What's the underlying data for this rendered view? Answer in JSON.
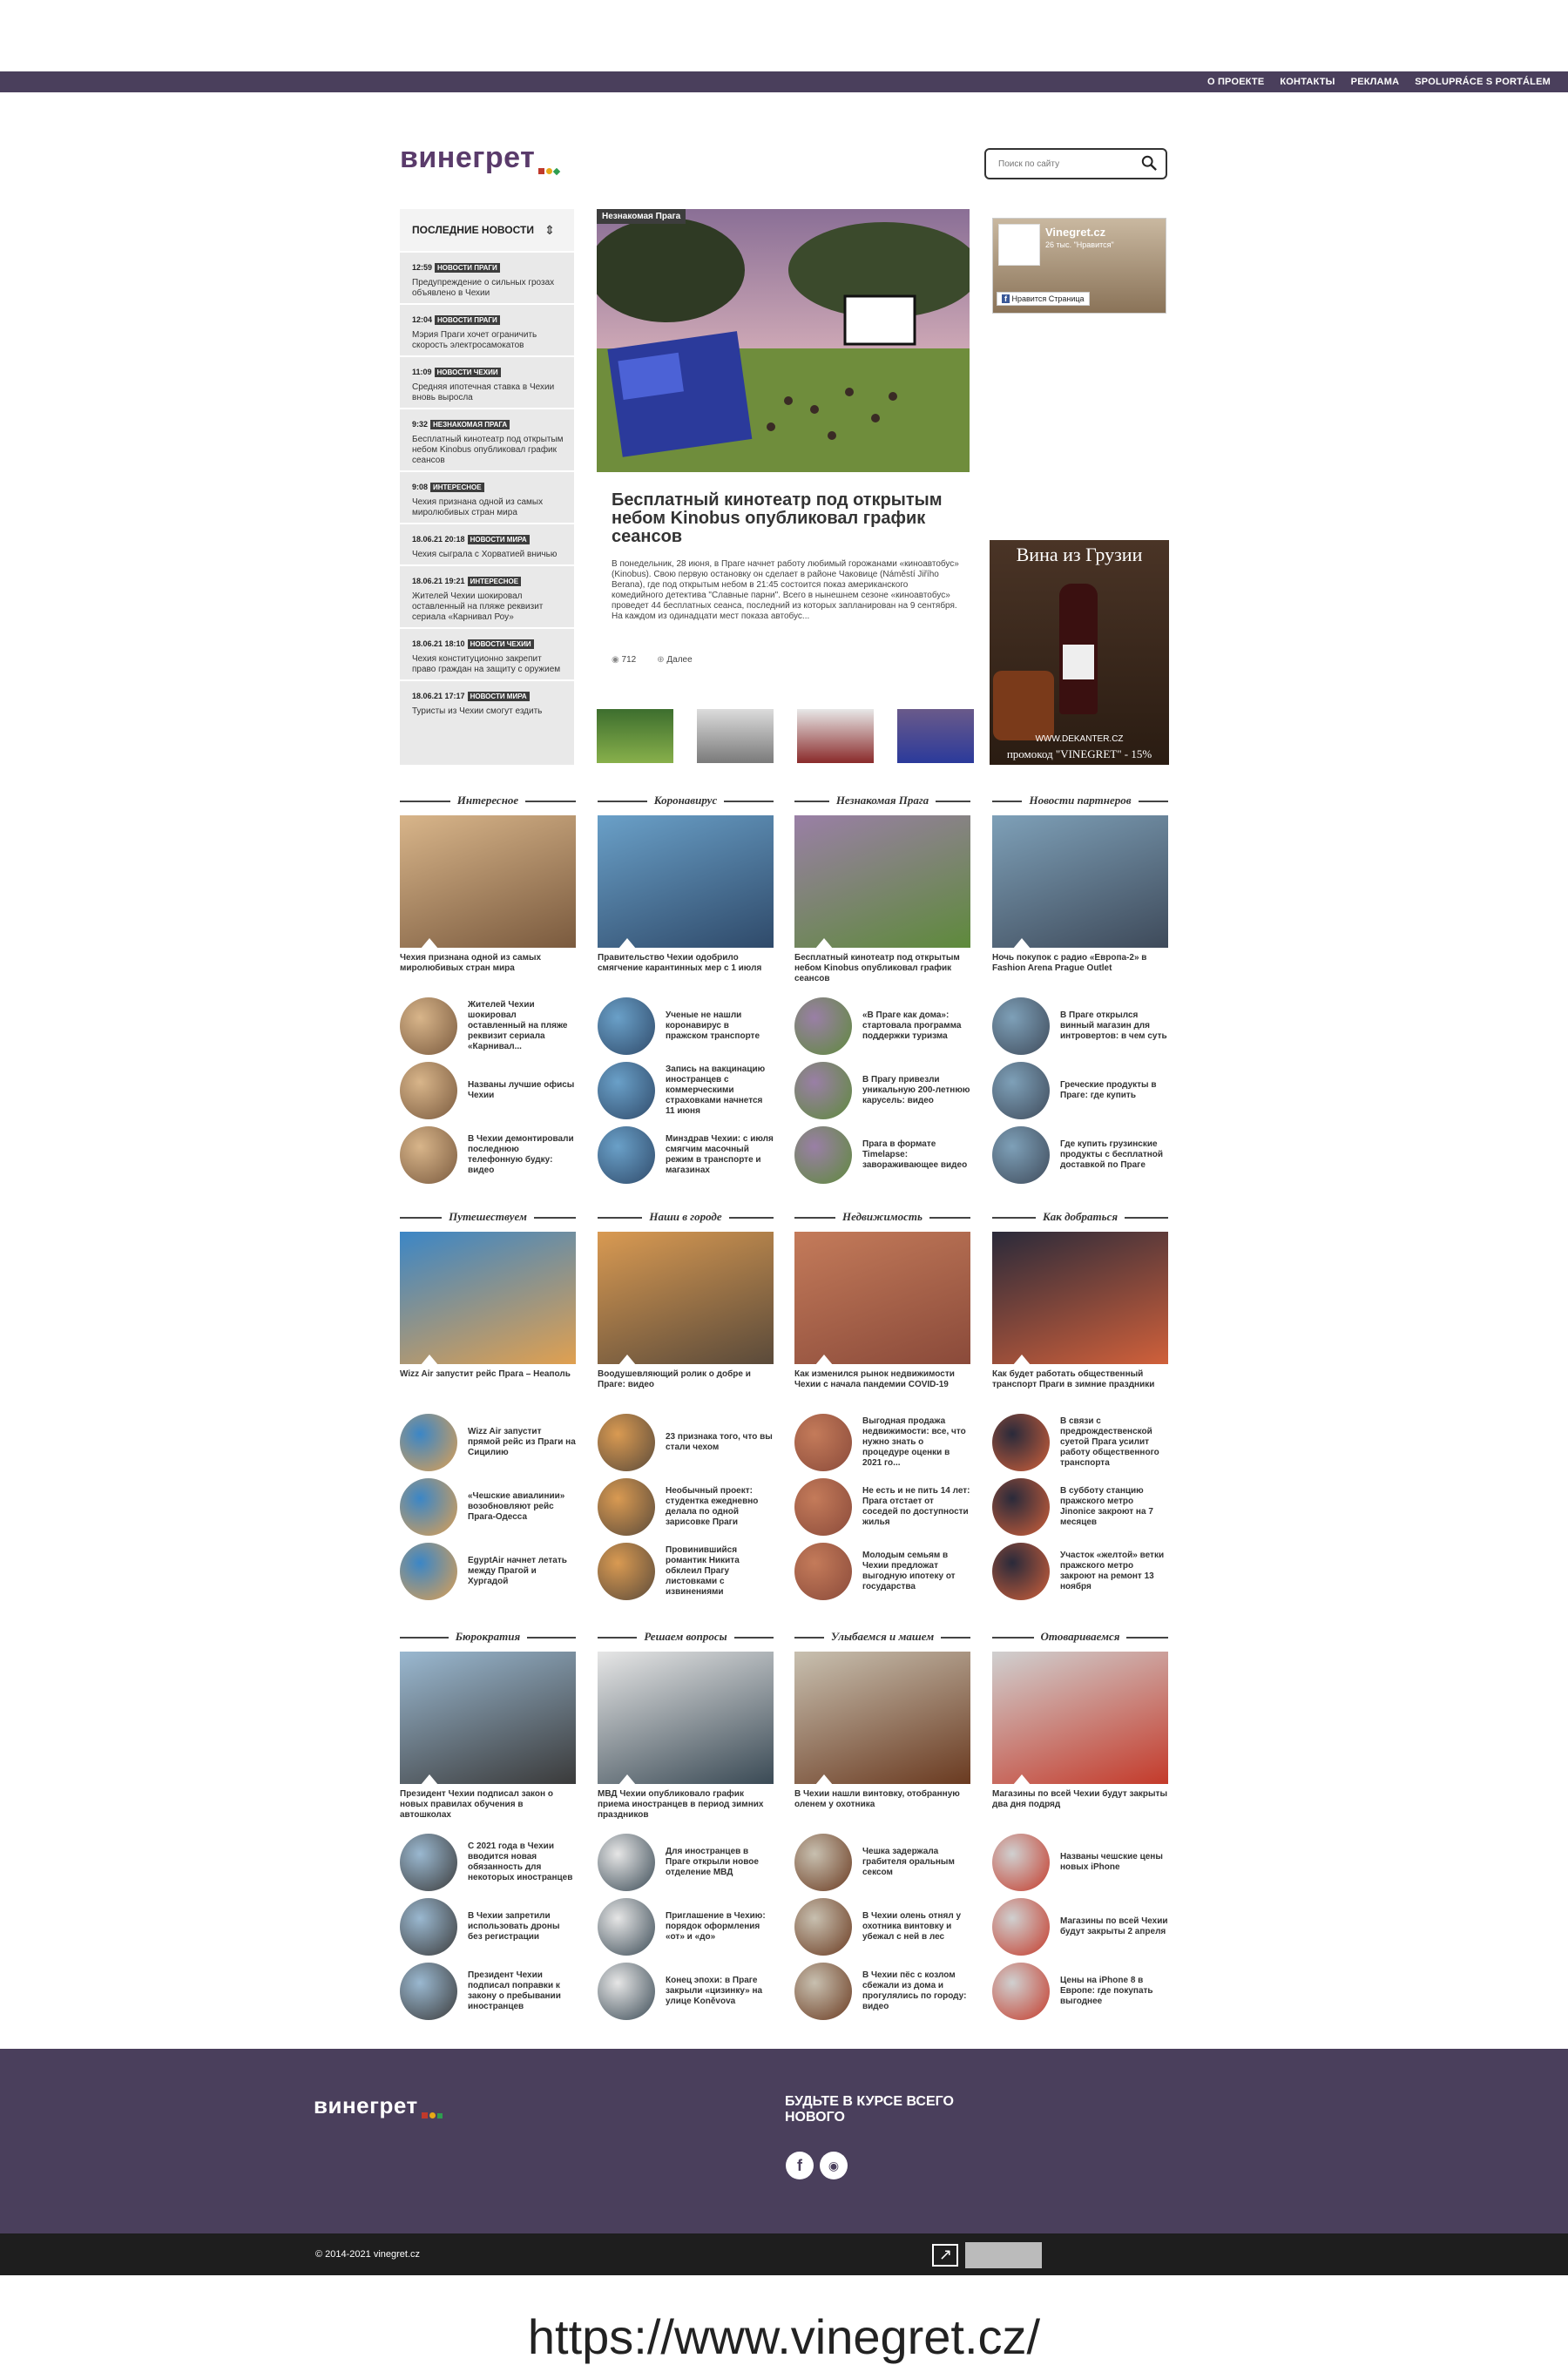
{
  "topnav": [
    "О ПРОЕКТЕ",
    "КОНТАКТЫ",
    "РЕКЛАМА",
    "SPOLUPRÁCE S PORTÁLEM"
  ],
  "logo": "винегрет",
  "search": {
    "placeholder": "Поиск по сайту"
  },
  "feed": {
    "title": "ПОСЛЕДНИЕ НОВОСТИ",
    "items": [
      {
        "time": "12:59",
        "tag": "НОВОСТИ ПРАГИ",
        "title": "Предупреждение о сильных грозах объявлено в Чехии"
      },
      {
        "time": "12:04",
        "tag": "НОВОСТИ ПРАГИ",
        "title": "Мэрия Праги хочет ограничить скорость электросамокатов"
      },
      {
        "time": "11:09",
        "tag": "НОВОСТИ ЧЕХИИ",
        "title": "Средняя ипотечная ставка в Чехии вновь выросла"
      },
      {
        "time": "9:32",
        "tag": "НЕЗНАКОМАЯ ПРАГА",
        "title": "Бесплатный кинотеатр под открытым небом Kinobus опубликовал график сеансов"
      },
      {
        "time": "9:08",
        "tag": "ИНТЕРЕСНОЕ",
        "title": "Чехия признана одной из самых миролюбивых стран мира"
      },
      {
        "time": "18.06.21 20:18",
        "tag": "НОВОСТИ МИРА",
        "title": "Чехия сыграла с Хорватией вничью"
      },
      {
        "time": "18.06.21 19:21",
        "tag": "ИНТЕРЕСНОЕ",
        "title": "Жителей Чехии шокировал оставленный на пляже реквизит сериала «Карнивал Роу»"
      },
      {
        "time": "18.06.21 18:10",
        "tag": "НОВОСТИ ЧЕХИИ",
        "title": "Чехия конституционно закрепит право граждан на защиту с оружием"
      },
      {
        "time": "18.06.21 17:17",
        "tag": "НОВОСТИ МИРА",
        "title": "Туристы из Чехии смогут ездить"
      }
    ]
  },
  "hero": {
    "tag": "Незнакомая Прага",
    "title": "Бесплатный кинотеатр под открытым небом Kinobus опубликовал график сеансов",
    "text": "В понедельник, 28 июня, в Праге начнет работу любимый горожанами «киноавтобус» (Kinobus). Свою первую остановку он сделает в районе Чаковице (Náměstí Jiřího Berana), где под открытым небом в 21:45 состоится показ американского комедийного детектива \"Славные парни\". Всего в нынешнем сезоне «киноавтобус» проведет 44 бесплатных сеанса, последний из которых запланирован на 9 сентября. На каждом из одинадцати мест показа автобус...",
    "views": "712",
    "more": "Далее"
  },
  "fb": {
    "name": "Vinegret.cz",
    "likes": "26 тыс. \"Нравится\"",
    "button": "Нравится Страница"
  },
  "ad": {
    "title": "Вина из Грузии",
    "site": "WWW.DEKANTER.CZ",
    "promo": "промокод \"VINEGRET\" - 15%"
  },
  "sections": [
    {
      "title": "Интересное",
      "main": "Чехия признана одной из самых миролюбивых стран мира",
      "subs": [
        "Жителей Чехии шокировал оставленный на пляже реквизит сериала «Карнивал...",
        "Названы лучшие офисы Чехии",
        "В Чехии демонтировали последнюю телефонную будку: видео"
      ]
    },
    {
      "title": "Коронавирус",
      "main": "Правительство Чехии одобрило смягчение карантинных мер с 1 июля",
      "subs": [
        "Ученые не нашли коронавирус в пражском транспорте",
        "Запись на вакцинацию иностранцев с коммерческими страховками начнется 11 июня",
        "Минздрав Чехии: с июля смягчим масочный режим в транспорте и магазинах"
      ]
    },
    {
      "title": "Незнакомая Прага",
      "main": "Бесплатный кинотеатр под открытым небом Kinobus опубликовал график сеансов",
      "subs": [
        "«В Праге как дома»: стартовала программа поддержки туризма",
        "В Прагу привезли уникальную 200-летнюю карусель: видео",
        "Прага в формате Timelapse: завораживающее видео"
      ]
    },
    {
      "title": "Новости партнеров",
      "main": "Ночь покупок с радио «Европа-2» в Fashion Arena Prague Outlet",
      "subs": [
        "В Праге открылся винный магазин для интровертов: в чем суть",
        "Греческие продукты в Праге: где купить",
        "Где купить грузинские продукты с бесплатной доставкой по Праге"
      ]
    },
    {
      "title": "Путешествуем",
      "main": "Wizz Air запустит рейс Прага – Неаполь",
      "subs": [
        "Wizz Air запустит прямой рейс из Праги на Сицилию",
        "«Чешские авиалинии» возобновляют рейс Прага-Одесса",
        "EgyptAir начнет летать между Прагой и Хургадой"
      ]
    },
    {
      "title": "Наши в городе",
      "main": "Воодушевляющий ролик о добре и Праге: видео",
      "subs": [
        "23 признака того, что вы стали чехом",
        "Необычный проект: студентка ежедневно делала по одной зарисовке Праги",
        "Провинившийся романтик Никита обклеил Прагу листовками с извинениями"
      ]
    },
    {
      "title": "Недвижимость",
      "main": "Как изменился рынок недвижимости Чехии с начала пандемии COVID-19",
      "subs": [
        "Выгодная продажа недвижимости: все, что нужно знать о процедуре оценки в 2021 го...",
        "Не есть и не пить 14 лет: Прага отстает от соседей по доступности жилья",
        "Молодым семьям в Чехии предложат выгодную ипотеку от государства"
      ]
    },
    {
      "title": "Как добраться",
      "main": "Как будет работать общественный транспорт Праги в зимние праздники",
      "subs": [
        "В связи с предрождественской суетой Прага усилит работу общественного транспорта",
        "В субботу станцию пражского метро Jinonice закроют на 7 месяцев",
        "Участок «желтой» ветки пражского метро закроют на ремонт 13 ноября"
      ]
    },
    {
      "title": "Бюрократия",
      "main": "Президент Чехии подписал закон о новых правилах обучения в автошколах",
      "subs": [
        "С 2021 года в Чехии вводится новая обязанность для некоторых иностранцев",
        "В Чехии запретили использовать дроны без регистрации",
        "Президент Чехии подписал поправки к закону о пребывании иностранцев"
      ]
    },
    {
      "title": "Решаем вопросы",
      "main": "МВД Чехии опубликовало график приема иностранцев в период зимних праздников",
      "subs": [
        "Для иностранцев в Праге открыли новое отделение МВД",
        "Приглашение в Чехию: порядок оформления «от» и «до»",
        "Конец эпохи: в Праге закрыли «цизинку» на улице Koněvova"
      ]
    },
    {
      "title": "Улыбаемся и машем",
      "main": "В Чехии нашли винтовку, отобранную оленем у охотника",
      "subs": [
        "Чешка задержала грабителя оральным сексом",
        "В Чехии олень отнял у охотника винтовку и убежал с ней в лес",
        "В Чехии пёс с козлом сбежали из дома и прогулялись по городу: видео"
      ]
    },
    {
      "title": "Отоваривaемся",
      "main": "Магазины по всей Чехии будут закрыты два дня подряд",
      "subs": [
        "Названы чешские цены новых iPhone",
        "Магазины по всей Чехии будут закрыты 2 апреля",
        "Цены на iPhone 8 в Европе: где покупать выгоднее"
      ]
    }
  ],
  "footer": {
    "subscribe": "БУДЬТЕ В КУРСЕ ВСЕГО НОВОГО",
    "copyright": "© 2014-2021 vinegret.cz"
  },
  "url": "https://www.vinegret.cz/"
}
